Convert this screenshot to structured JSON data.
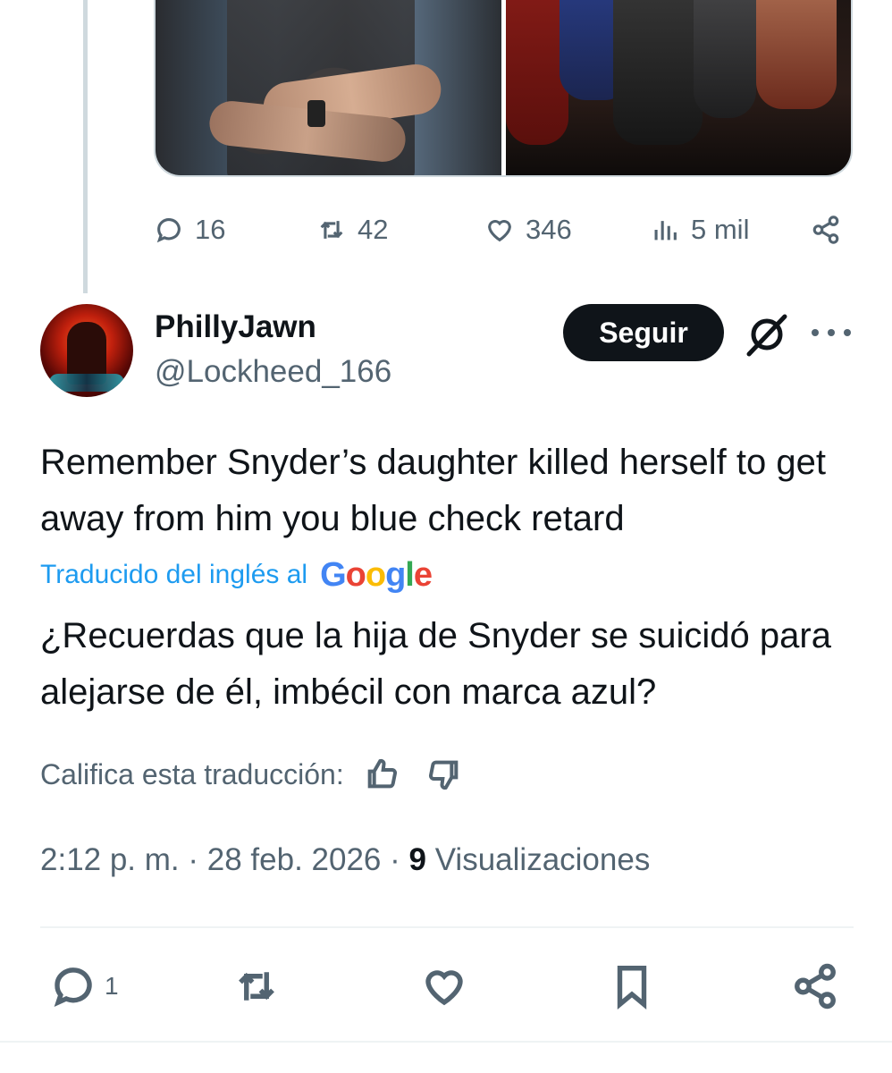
{
  "parent_tweet": {
    "stats": {
      "replies": "16",
      "retweets": "42",
      "likes": "346",
      "views": "5 mil"
    }
  },
  "tweet": {
    "author": {
      "display_name": "PhillyJawn",
      "handle": "@Lockheed_166"
    },
    "follow_label": "Seguir",
    "text": "Remember Snyder’s daughter killed herself to get away from him you blue check retard",
    "translated_by_label": "Traducido del inglés al",
    "translation_provider": "Google",
    "translation": "¿Recuerdas que la hija de Snyder se suicidó para alejarse de él, imbécil con marca azul?",
    "rate_label": "Califica esta traducción:",
    "time": "2:12 p. m.",
    "date": "28 feb. 2026",
    "separator": "·",
    "views_count": "9",
    "views_label": "Visualizaciones",
    "actions": {
      "replies": "1"
    }
  },
  "icons": {
    "reply": "reply-icon",
    "retweet": "retweet-icon",
    "like": "heart-icon",
    "views": "analytics-icon",
    "share": "share-icon",
    "bookmark": "bookmark-icon",
    "grok": "grok-icon",
    "more": "more-icon",
    "thumbs_up": "thumbs-up-icon",
    "thumbs_down": "thumbs-down-icon"
  },
  "colors": {
    "text": "#0f1419",
    "secondary": "#536471",
    "link": "#1d9bf0",
    "follow_bg": "#0f1419",
    "divider": "#eff3f4"
  }
}
